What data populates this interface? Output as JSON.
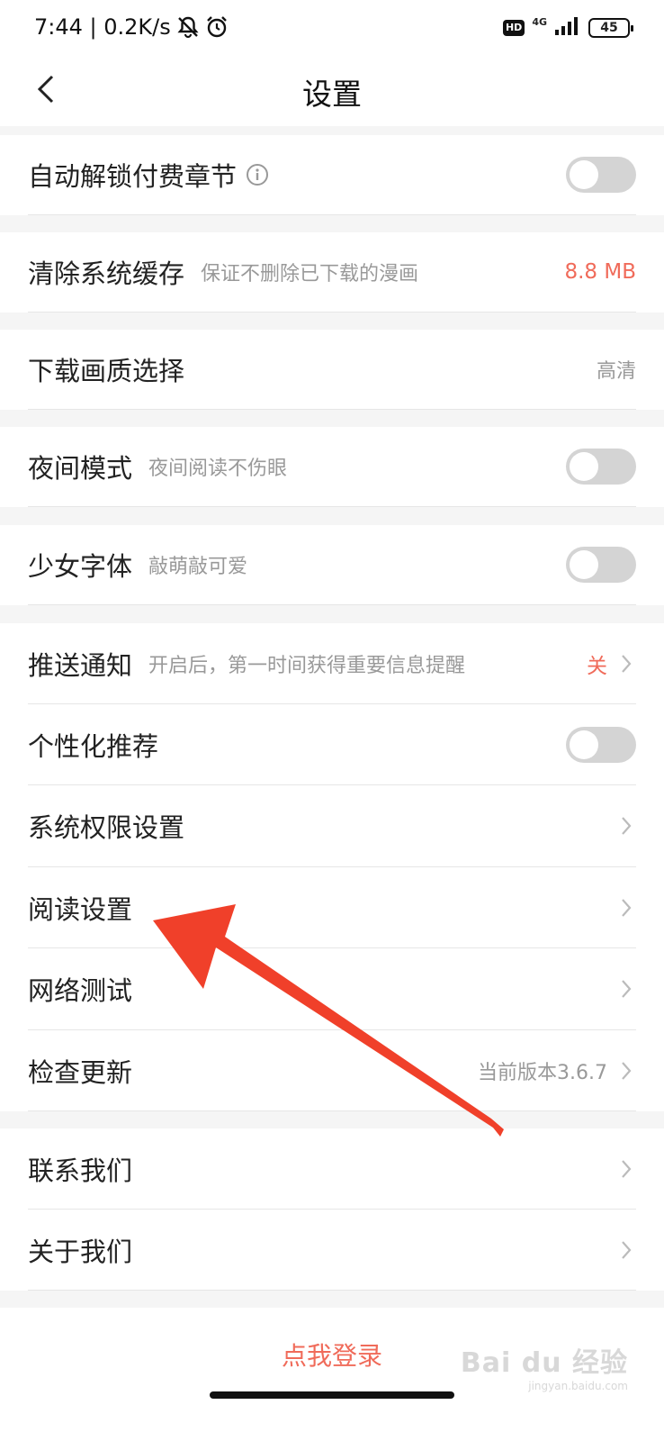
{
  "status_bar": {
    "time_speed": "7:44 | 0.2K/s",
    "hd": "HD",
    "network": "4G",
    "battery": "45"
  },
  "header": {
    "title": "设置"
  },
  "settings": {
    "auto_unlock": {
      "label": "自动解锁付费章节",
      "toggle_on": false
    },
    "clear_cache": {
      "label": "清除系统缓存",
      "sub": "保证不删除已下载的漫画",
      "value": "8.8 MB"
    },
    "download_quality": {
      "label": "下载画质选择",
      "value": "高清"
    },
    "night_mode": {
      "label": "夜间模式",
      "sub": "夜间阅读不伤眼",
      "toggle_on": false
    },
    "girl_font": {
      "label": "少女字体",
      "sub": "敲萌敲可爱",
      "toggle_on": false
    },
    "push": {
      "label": "推送通知",
      "sub": "开启后，第一时间获得重要信息提醒",
      "value": "关"
    },
    "personalized": {
      "label": "个性化推荐",
      "toggle_on": false
    },
    "permissions": {
      "label": "系统权限设置"
    },
    "reading": {
      "label": "阅读设置"
    },
    "network_test": {
      "label": "网络测试"
    },
    "check_update": {
      "label": "检查更新",
      "value": "当前版本3.6.7"
    },
    "contact": {
      "label": "联系我们"
    },
    "about": {
      "label": "关于我们"
    }
  },
  "login": {
    "label": "点我登录"
  },
  "watermark": {
    "logo": "Bai du 经验",
    "url": "jingyan.baidu.com"
  },
  "colors": {
    "accent": "#f06b5a",
    "annotation_arrow": "#f0402a",
    "toggle_off": "#d4d4d4"
  }
}
